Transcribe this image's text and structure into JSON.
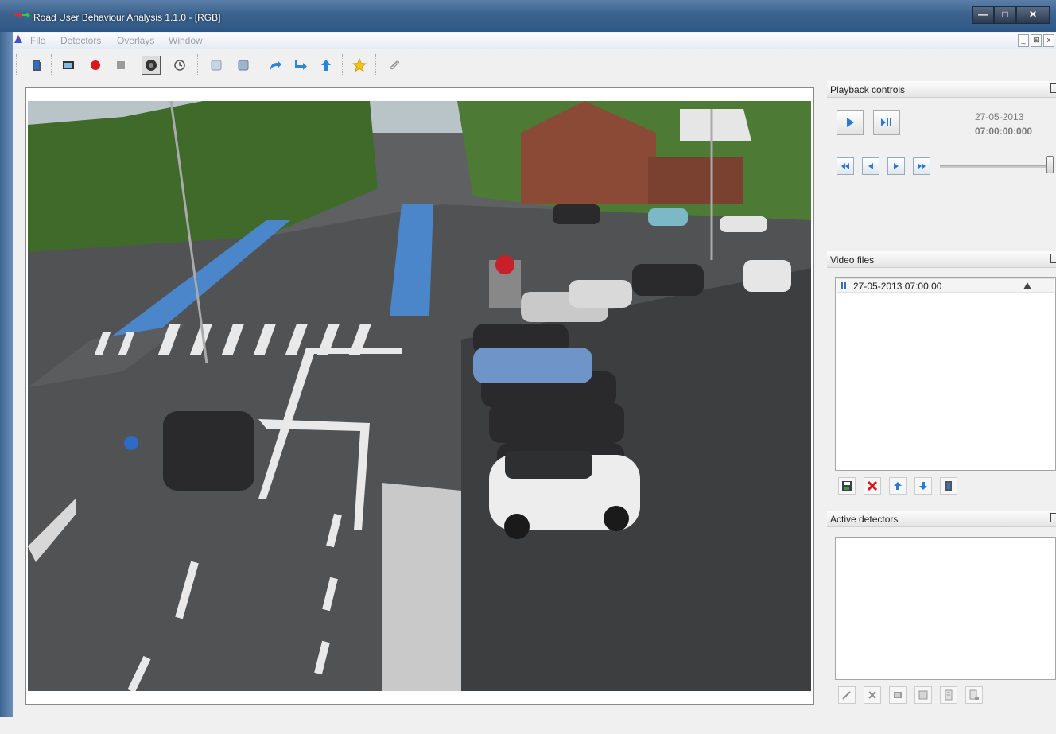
{
  "window": {
    "title": "Road User Behaviour Analysis 1.1.0 - [RGB]",
    "caption_buttons": [
      "minimize",
      "maximize",
      "close"
    ]
  },
  "menu": {
    "items": [
      "File",
      "Detectors",
      "Overlays",
      "Window"
    ]
  },
  "toolbar": {
    "buttons": [
      {
        "name": "open-video-icon"
      },
      {
        "name": "frame-icon"
      },
      {
        "name": "record-icon",
        "color": "#d9161c"
      },
      {
        "name": "stop-icon"
      },
      {
        "name": "camera-icon",
        "pressed": true
      },
      {
        "name": "clock-icon"
      },
      {
        "name": "mask-icon"
      },
      {
        "name": "overlay-icon"
      },
      {
        "name": "redo-icon"
      },
      {
        "name": "forward-arrow-icon"
      },
      {
        "name": "up-arrow-icon"
      },
      {
        "name": "star-icon"
      },
      {
        "name": "paperclip-icon"
      }
    ]
  },
  "playback": {
    "header": "Playback controls",
    "date": "27-05-2013",
    "time": "07:00:00:000",
    "slider_position": 1.0
  },
  "video_files": {
    "header": "Video files",
    "items": [
      {
        "label": "27-05-2013 07:00:00"
      }
    ]
  },
  "active_detectors": {
    "header": "Active detectors"
  },
  "colors": {
    "accent_blue": "#3b6bbd",
    "title_bar": "#3e6591",
    "desktop": "#f4e06a"
  }
}
